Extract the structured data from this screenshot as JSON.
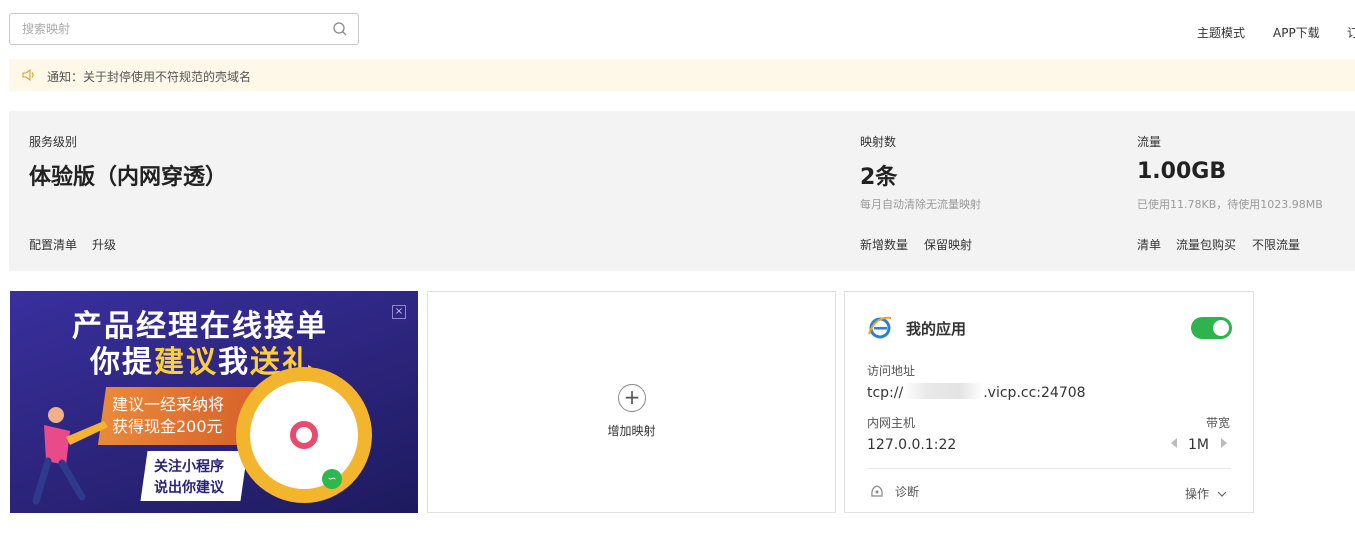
{
  "search": {
    "placeholder": "搜索映射"
  },
  "topnav": {
    "theme": "主题模式",
    "app_download": "APP下载",
    "cut": "订"
  },
  "notice": {
    "text": "通知：关于封停使用不符规范的壳域名"
  },
  "summary": {
    "level_label": "服务级别",
    "level_value": "体验版（内网穿透）",
    "level_links": [
      "配置清单",
      "升级"
    ],
    "mapping_label": "映射数",
    "mapping_value": "2条",
    "mapping_sub": "每月自动清除无流量映射",
    "mapping_links": [
      "新增数量",
      "保留映射"
    ],
    "traffic_label": "流量",
    "traffic_value": "1.00GB",
    "traffic_sub": "已使用11.78KB，待使用1023.98MB",
    "traffic_links": [
      "清单",
      "流量包购买",
      "不限流量"
    ]
  },
  "banner": {
    "line1": "产品经理在线接单",
    "line2_a": "你提",
    "line2_b": "建议",
    "line2_c": "我",
    "line2_d": "送礼",
    "note1": "建议一经采纳将",
    "note2": "获得现金200元",
    "tag1": "关注小程序",
    "tag2": "说出你建议",
    "close": "×",
    "mini_icon": "∽"
  },
  "add_mapping": {
    "plus": "+",
    "label": "增加映射"
  },
  "app": {
    "title": "我的应用",
    "enabled": true,
    "address_label": "访问地址",
    "address_prefix": "tcp://",
    "address_suffix": ".vicp.cc:24708",
    "host_label": "内网主机",
    "host_value": "127.0.0.1:22",
    "bandwidth_label": "带宽",
    "bandwidth_value": "1M",
    "diagnose": "诊断",
    "operate": "操作"
  },
  "colors": {
    "accent_green": "#2eb34f",
    "notice_bg": "#fdf8e7",
    "summary_bg": "#f3f3f3",
    "banner_bg": "#2a2378"
  },
  "icons": [
    "search-icon",
    "speaker-icon",
    "close-icon",
    "plus-icon",
    "ie-icon",
    "diagnose-icon",
    "chevron-down-icon",
    "arrow-left-icon",
    "arrow-right-icon"
  ]
}
